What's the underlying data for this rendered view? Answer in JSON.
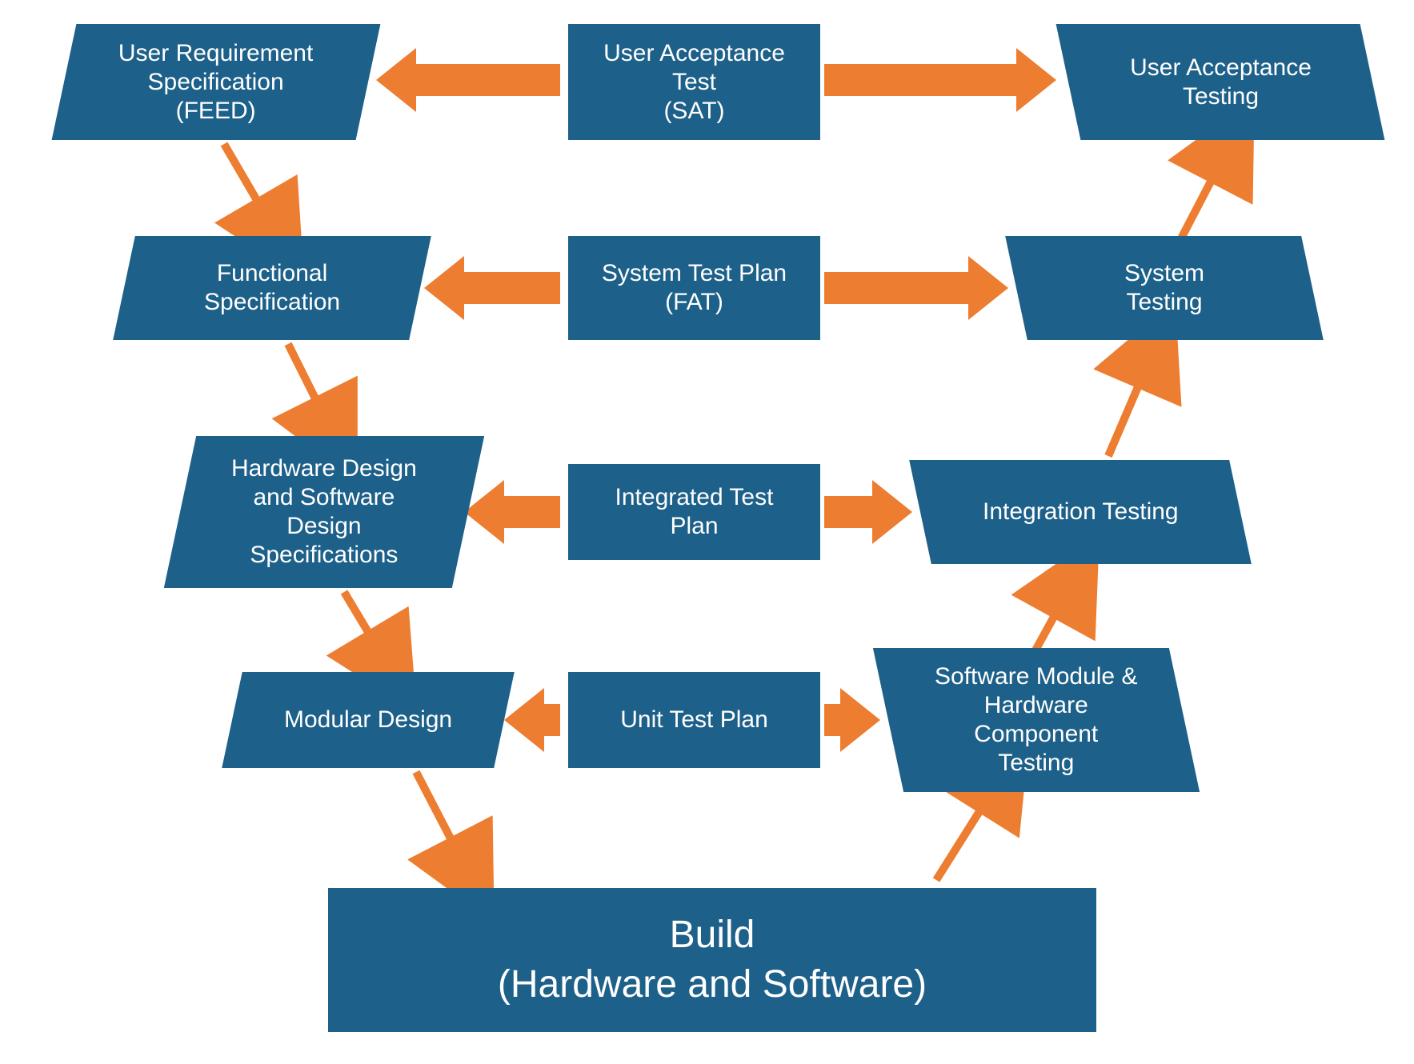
{
  "colors": {
    "box": "#1d6089",
    "arrow": "#ed7d31",
    "text": "#ffffff"
  },
  "diagram": {
    "type": "v-model",
    "left": [
      "User Requirement Specification (FEED)",
      "Functional Specification",
      "Hardware Design and Software Design Specifications",
      "Modular Design"
    ],
    "center": [
      "User Acceptance Test (SAT)",
      "System Test Plan (FAT)",
      "Integrated Test Plan",
      "Unit Test Plan"
    ],
    "right": [
      "User Acceptance Testing",
      "System Testing",
      "Integration Testing",
      "Software Module & Hardware Component Testing"
    ],
    "bottom": "Build (Hardware and Software)"
  },
  "labels": {
    "l0a": "User Requirement",
    "l0b": "Specification",
    "l0c": "(FEED)",
    "l1a": "Functional",
    "l1b": "Specification",
    "l2a": "Hardware Design",
    "l2b": "and Software",
    "l2c": "Design",
    "l2d": "Specifications",
    "l3a": "Modular Design",
    "c0a": "User Acceptance",
    "c0b": "Test",
    "c0c": "(SAT)",
    "c1a": "System Test Plan",
    "c1b": "(FAT)",
    "c2a": "Integrated Test",
    "c2b": "Plan",
    "c3a": "Unit Test Plan",
    "r0a": "User Acceptance",
    "r0b": "Testing",
    "r1a": "System",
    "r1b": "Testing",
    "r2a": "Integration Testing",
    "r3a": "Software Module &",
    "r3b": "Hardware",
    "r3c": "Component",
    "r3d": "Testing",
    "b0a": "Build",
    "b0b": "(Hardware and Software)"
  }
}
